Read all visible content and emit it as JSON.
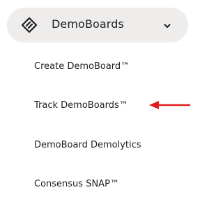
{
  "nav": {
    "title": "DemoBoards",
    "logo_icon": "demoboards-logo-icon",
    "expand_icon": "chevron-down-icon",
    "items": [
      {
        "label": "Create DemoBoard™"
      },
      {
        "label": "Track DemoBoards™"
      },
      {
        "label": "DemoBoard Demolytics"
      },
      {
        "label": "Consensus SNAP™"
      }
    ]
  },
  "annotation": {
    "arrow_icon": "red-pointer-arrow-icon",
    "color": "#e01b1b"
  },
  "colors": {
    "header_bg": "#efecec",
    "text": "#1f1f1f"
  }
}
